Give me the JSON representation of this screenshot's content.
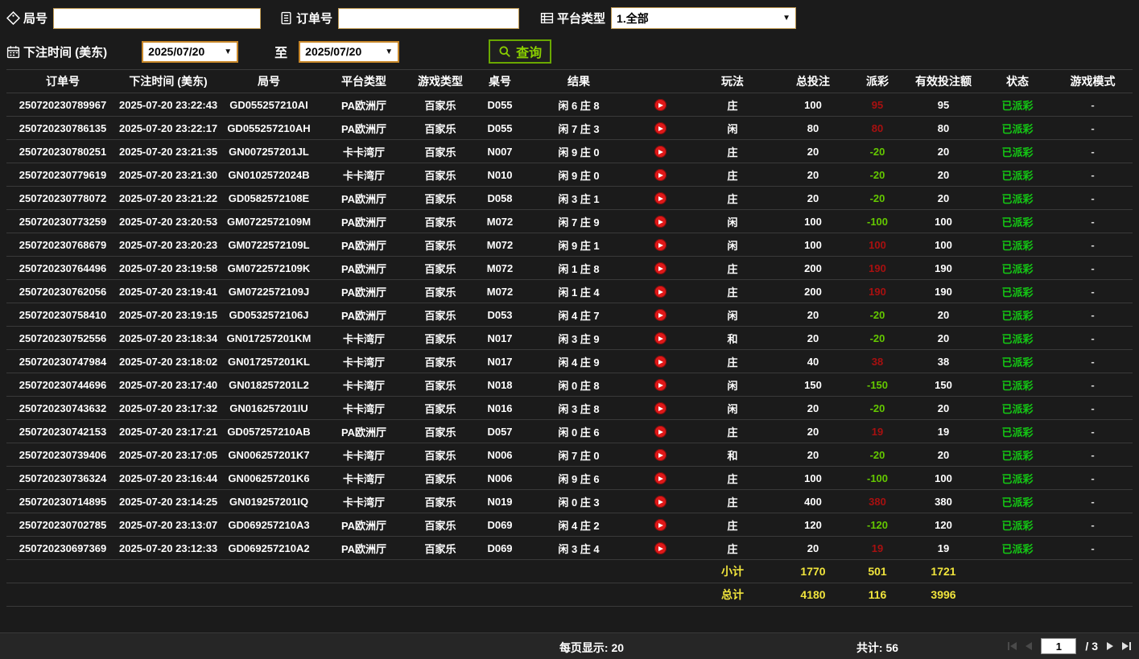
{
  "filters": {
    "game_no_label": "局号",
    "order_no_label": "订单号",
    "platform_label": "平台类型",
    "platform_value": "1.全部",
    "bet_time_label": "下注时间 (美东)",
    "date_from": "2025/07/20",
    "to_label": "至",
    "date_to": "2025/07/20",
    "search_label": "查询"
  },
  "table": {
    "headers": [
      "订单号",
      "下注时间 (美东)",
      "局号",
      "平台类型",
      "游戏类型",
      "桌号",
      "结果",
      "",
      "玩法",
      "总投注",
      "派彩",
      "有效投注额",
      "状态",
      "游戏模式"
    ],
    "rows": [
      [
        "250720230789967",
        "2025-07-20 23:22:43",
        "GD055257210AI",
        "PA欧洲厅",
        "百家乐",
        "D055",
        "闲 6 庄 8",
        "庄",
        "100",
        "95",
        "95",
        "已派彩",
        "-"
      ],
      [
        "250720230786135",
        "2025-07-20 23:22:17",
        "GD055257210AH",
        "PA欧洲厅",
        "百家乐",
        "D055",
        "闲 7 庄 3",
        "闲",
        "80",
        "80",
        "80",
        "已派彩",
        "-"
      ],
      [
        "250720230780251",
        "2025-07-20 23:21:35",
        "GN007257201JL",
        "卡卡湾厅",
        "百家乐",
        "N007",
        "闲 9 庄 0",
        "庄",
        "20",
        "-20",
        "20",
        "已派彩",
        "-"
      ],
      [
        "250720230779619",
        "2025-07-20 23:21:30",
        "GN0102572024B",
        "卡卡湾厅",
        "百家乐",
        "N010",
        "闲 9 庄 0",
        "庄",
        "20",
        "-20",
        "20",
        "已派彩",
        "-"
      ],
      [
        "250720230778072",
        "2025-07-20 23:21:22",
        "GD0582572108E",
        "PA欧洲厅",
        "百家乐",
        "D058",
        "闲 3 庄 1",
        "庄",
        "20",
        "-20",
        "20",
        "已派彩",
        "-"
      ],
      [
        "250720230773259",
        "2025-07-20 23:20:53",
        "GM0722572109M",
        "PA欧洲厅",
        "百家乐",
        "M072",
        "闲 7 庄 9",
        "闲",
        "100",
        "-100",
        "100",
        "已派彩",
        "-"
      ],
      [
        "250720230768679",
        "2025-07-20 23:20:23",
        "GM0722572109L",
        "PA欧洲厅",
        "百家乐",
        "M072",
        "闲 9 庄 1",
        "闲",
        "100",
        "100",
        "100",
        "已派彩",
        "-"
      ],
      [
        "250720230764496",
        "2025-07-20 23:19:58",
        "GM0722572109K",
        "PA欧洲厅",
        "百家乐",
        "M072",
        "闲 1 庄 8",
        "庄",
        "200",
        "190",
        "190",
        "已派彩",
        "-"
      ],
      [
        "250720230762056",
        "2025-07-20 23:19:41",
        "GM0722572109J",
        "PA欧洲厅",
        "百家乐",
        "M072",
        "闲 1 庄 4",
        "庄",
        "200",
        "190",
        "190",
        "已派彩",
        "-"
      ],
      [
        "250720230758410",
        "2025-07-20 23:19:15",
        "GD0532572106J",
        "PA欧洲厅",
        "百家乐",
        "D053",
        "闲 4 庄 7",
        "闲",
        "20",
        "-20",
        "20",
        "已派彩",
        "-"
      ],
      [
        "250720230752556",
        "2025-07-20 23:18:34",
        "GN017257201KM",
        "卡卡湾厅",
        "百家乐",
        "N017",
        "闲 3 庄 9",
        "和",
        "20",
        "-20",
        "20",
        "已派彩",
        "-"
      ],
      [
        "250720230747984",
        "2025-07-20 23:18:02",
        "GN017257201KL",
        "卡卡湾厅",
        "百家乐",
        "N017",
        "闲 4 庄 9",
        "庄",
        "40",
        "38",
        "38",
        "已派彩",
        "-"
      ],
      [
        "250720230744696",
        "2025-07-20 23:17:40",
        "GN018257201L2",
        "卡卡湾厅",
        "百家乐",
        "N018",
        "闲 0 庄 8",
        "闲",
        "150",
        "-150",
        "150",
        "已派彩",
        "-"
      ],
      [
        "250720230743632",
        "2025-07-20 23:17:32",
        "GN016257201IU",
        "卡卡湾厅",
        "百家乐",
        "N016",
        "闲 3 庄 8",
        "闲",
        "20",
        "-20",
        "20",
        "已派彩",
        "-"
      ],
      [
        "250720230742153",
        "2025-07-20 23:17:21",
        "GD057257210AB",
        "PA欧洲厅",
        "百家乐",
        "D057",
        "闲 0 庄 6",
        "庄",
        "20",
        "19",
        "19",
        "已派彩",
        "-"
      ],
      [
        "250720230739406",
        "2025-07-20 23:17:05",
        "GN006257201K7",
        "卡卡湾厅",
        "百家乐",
        "N006",
        "闲 7 庄 0",
        "和",
        "20",
        "-20",
        "20",
        "已派彩",
        "-"
      ],
      [
        "250720230736324",
        "2025-07-20 23:16:44",
        "GN006257201K6",
        "卡卡湾厅",
        "百家乐",
        "N006",
        "闲 9 庄 6",
        "庄",
        "100",
        "-100",
        "100",
        "已派彩",
        "-"
      ],
      [
        "250720230714895",
        "2025-07-20 23:14:25",
        "GN019257201IQ",
        "卡卡湾厅",
        "百家乐",
        "N019",
        "闲 0 庄 3",
        "庄",
        "400",
        "380",
        "380",
        "已派彩",
        "-"
      ],
      [
        "250720230702785",
        "2025-07-20 23:13:07",
        "GD069257210A3",
        "PA欧洲厅",
        "百家乐",
        "D069",
        "闲 4 庄 2",
        "庄",
        "120",
        "-120",
        "120",
        "已派彩",
        "-"
      ],
      [
        "250720230697369",
        "2025-07-20 23:12:33",
        "GD069257210A2",
        "PA欧洲厅",
        "百家乐",
        "D069",
        "闲 3 庄 4",
        "庄",
        "20",
        "19",
        "19",
        "已派彩",
        "-"
      ]
    ],
    "subtotal": {
      "label": "小计",
      "total_bet": "1770",
      "payout": "501",
      "valid_bet": "1721"
    },
    "total": {
      "label": "总计",
      "total_bet": "4180",
      "payout": "116",
      "valid_bet": "3996"
    }
  },
  "footer": {
    "per_page": "每页显示: 20",
    "total_count": "共计: 56",
    "page_value": "1",
    "page_total_label": "/ 3"
  },
  "colors": {
    "status_green": "#14c814",
    "payout_positive_red": "#a81010",
    "payout_negative_green": "#64c800",
    "summary_yellow": "#f0e43c",
    "search_button_green": "#8ad000",
    "date_border_orange": "#c8882a",
    "play_button_red": "#e01818"
  }
}
